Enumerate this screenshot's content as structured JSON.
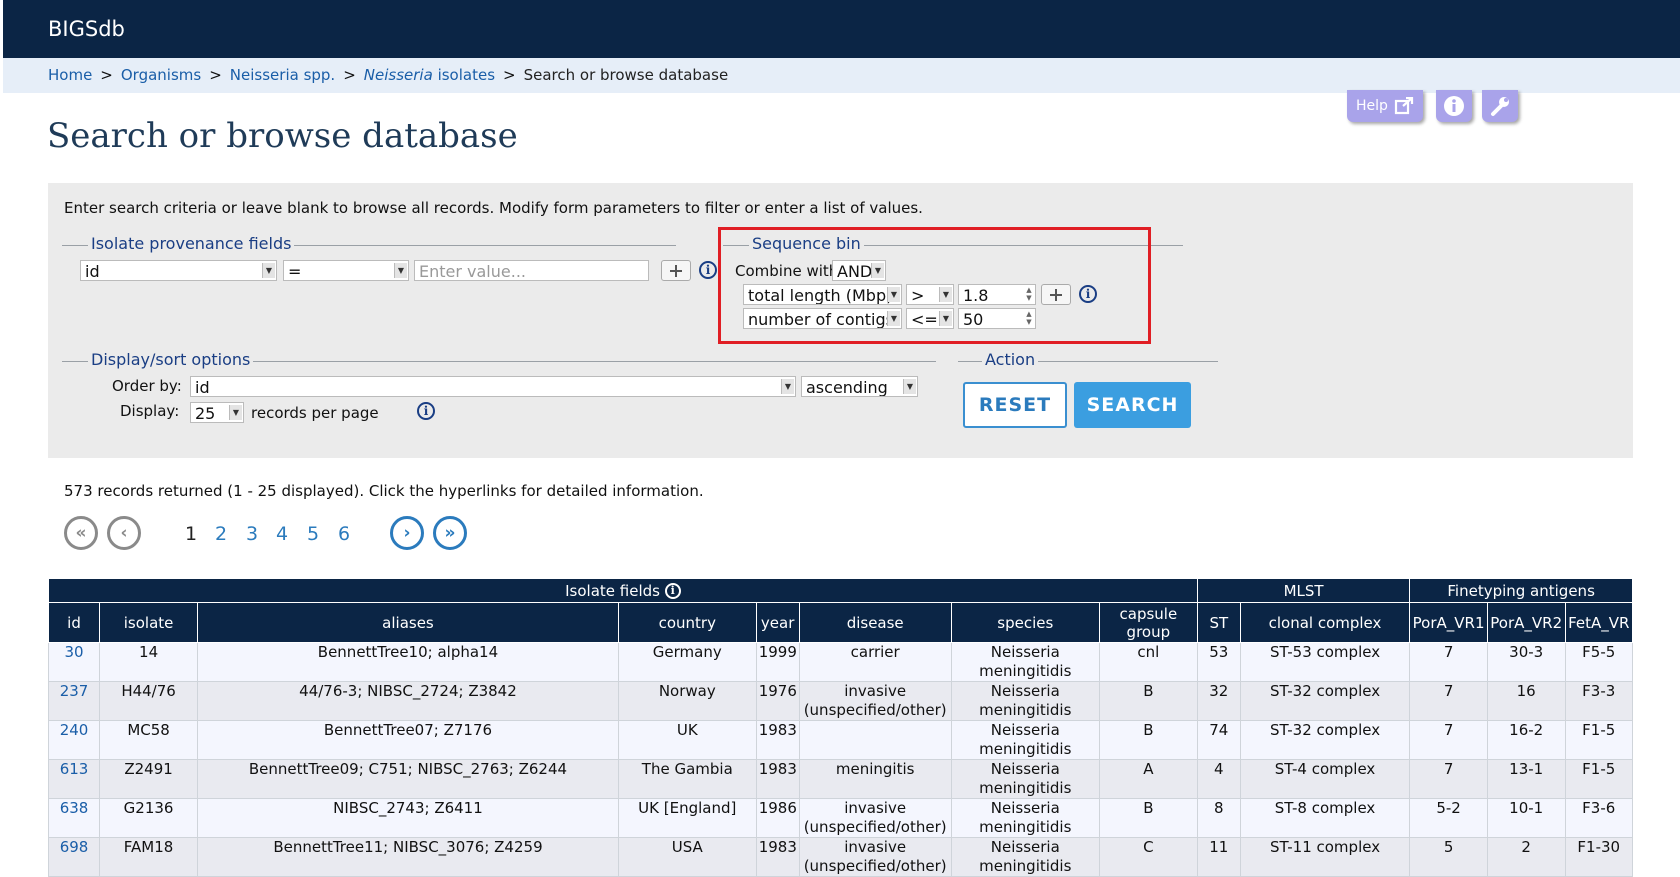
{
  "header": {
    "brand": "BIGSdb"
  },
  "breadcrumb": [
    {
      "label": "Home"
    },
    {
      "label": "Organisms"
    },
    {
      "label": "Neisseria spp."
    },
    {
      "label_italic": "Neisseria",
      "label_rest": " isolates"
    },
    {
      "label": "Search or browse database"
    }
  ],
  "breadcrumb_sep": ">",
  "toolbar": {
    "help_label": "Help"
  },
  "page": {
    "title": "Search or browse database"
  },
  "form": {
    "instructions": "Enter search criteria or leave blank to browse all records. Modify form parameters to filter or enter a list of values.",
    "provenance": {
      "legend": "Isolate provenance fields",
      "field": "id",
      "operator": "=",
      "value_placeholder": "Enter value..."
    },
    "seqbin": {
      "legend": "Sequence bin",
      "combine_label": "Combine with:",
      "combine_value": "AND",
      "rows": [
        {
          "field": "total length (Mbp)",
          "operator": ">",
          "value": "1.8"
        },
        {
          "field": "number of contigs",
          "operator": "<=",
          "value": "50"
        }
      ]
    },
    "display": {
      "legend": "Display/sort options",
      "order_label": "Order by:",
      "order_value": "id",
      "direction": "ascending",
      "display_label": "Display:",
      "display_value": "25",
      "per_page": "records per page"
    },
    "action": {
      "legend": "Action",
      "reset": "RESET",
      "search": "SEARCH"
    }
  },
  "results": {
    "summary": "573 records returned (1 - 25 displayed). Click the hyperlinks for detailed information.",
    "pages": [
      "1",
      "2",
      "3",
      "4",
      "5",
      "6"
    ],
    "groups": {
      "isolate": "Isolate fields",
      "mlst": "MLST",
      "fine": "Finetyping antigens"
    },
    "columns": [
      "id",
      "isolate",
      "aliases",
      "country",
      "year",
      "disease",
      "species",
      "capsule group",
      "ST",
      "clonal complex",
      "PorA_VR1",
      "PorA_VR2",
      "FetA_VR"
    ],
    "rows": [
      [
        "30",
        "14",
        "BennettTree10; alpha14",
        "Germany",
        "1999",
        "carrier",
        "Neisseria meningitidis",
        "cnl",
        "53",
        "ST-53 complex",
        "7",
        "30-3",
        "F5-5"
      ],
      [
        "237",
        "H44/76",
        "44/76-3; NIBSC_2724; Z3842",
        "Norway",
        "1976",
        "invasive (unspecified/other)",
        "Neisseria meningitidis",
        "B",
        "32",
        "ST-32 complex",
        "7",
        "16",
        "F3-3"
      ],
      [
        "240",
        "MC58",
        "BennettTree07; Z7176",
        "UK",
        "1983",
        "",
        "Neisseria meningitidis",
        "B",
        "74",
        "ST-32 complex",
        "7",
        "16-2",
        "F1-5"
      ],
      [
        "613",
        "Z2491",
        "BennettTree09; C751; NIBSC_2763; Z6244",
        "The Gambia",
        "1983",
        "meningitis",
        "Neisseria meningitidis",
        "A",
        "4",
        "ST-4 complex",
        "7",
        "13-1",
        "F1-5"
      ],
      [
        "638",
        "G2136",
        "NIBSC_2743; Z6411",
        "UK [England]",
        "1986",
        "invasive (unspecified/other)",
        "Neisseria meningitidis",
        "B",
        "8",
        "ST-8 complex",
        "5-2",
        "10-1",
        "F3-6"
      ],
      [
        "698",
        "FAM18",
        "BennettTree11; NIBSC_3076; Z4259",
        "USA",
        "1983",
        "invasive (unspecified/other)",
        "Neisseria meningitidis",
        "C",
        "11",
        "ST-11 complex",
        "5",
        "2",
        "F1-30"
      ]
    ]
  }
}
